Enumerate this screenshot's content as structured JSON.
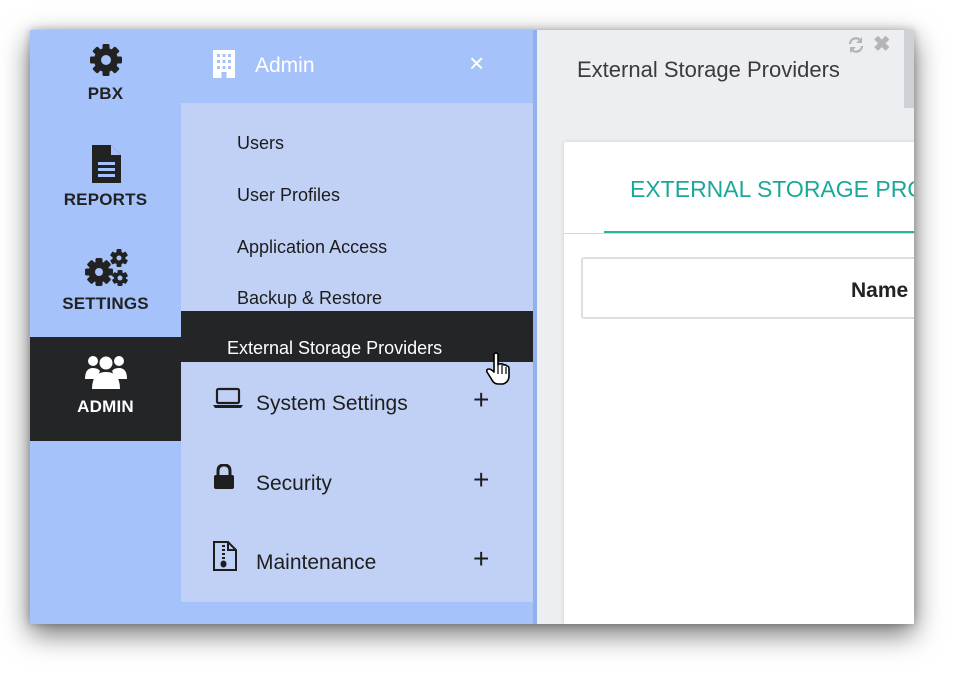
{
  "rail": {
    "items": [
      {
        "label": "PBX",
        "icon": "gear-icon"
      },
      {
        "label": "REPORTS",
        "icon": "document-icon"
      },
      {
        "label": "SETTINGS",
        "icon": "gears-icon"
      },
      {
        "label": "ADMIN",
        "icon": "users-icon",
        "active": true
      }
    ]
  },
  "panel": {
    "title": "Admin",
    "close": "×",
    "subitems": [
      "Users",
      "User Profiles",
      "Application Access",
      "Backup & Restore",
      "External Storage Providers"
    ],
    "active_subitem": "External Storage Providers",
    "groups": [
      {
        "label": "System Settings",
        "icon": "laptop-icon",
        "toggle": "+"
      },
      {
        "label": "Security",
        "icon": "lock-icon",
        "toggle": "+"
      },
      {
        "label": "Maintenance",
        "icon": "zip-file-icon",
        "toggle": "+"
      }
    ]
  },
  "content": {
    "page_title": "External Storage Providers",
    "close": "✖",
    "tab_label": "EXTERNAL STORAGE PROVIDERS",
    "column_header": "Name"
  },
  "colors": {
    "rail_bg": "#a6c2fb",
    "panel_bg": "#c1d1f6",
    "active_bg": "#232527",
    "accent": "#1aa89a"
  }
}
